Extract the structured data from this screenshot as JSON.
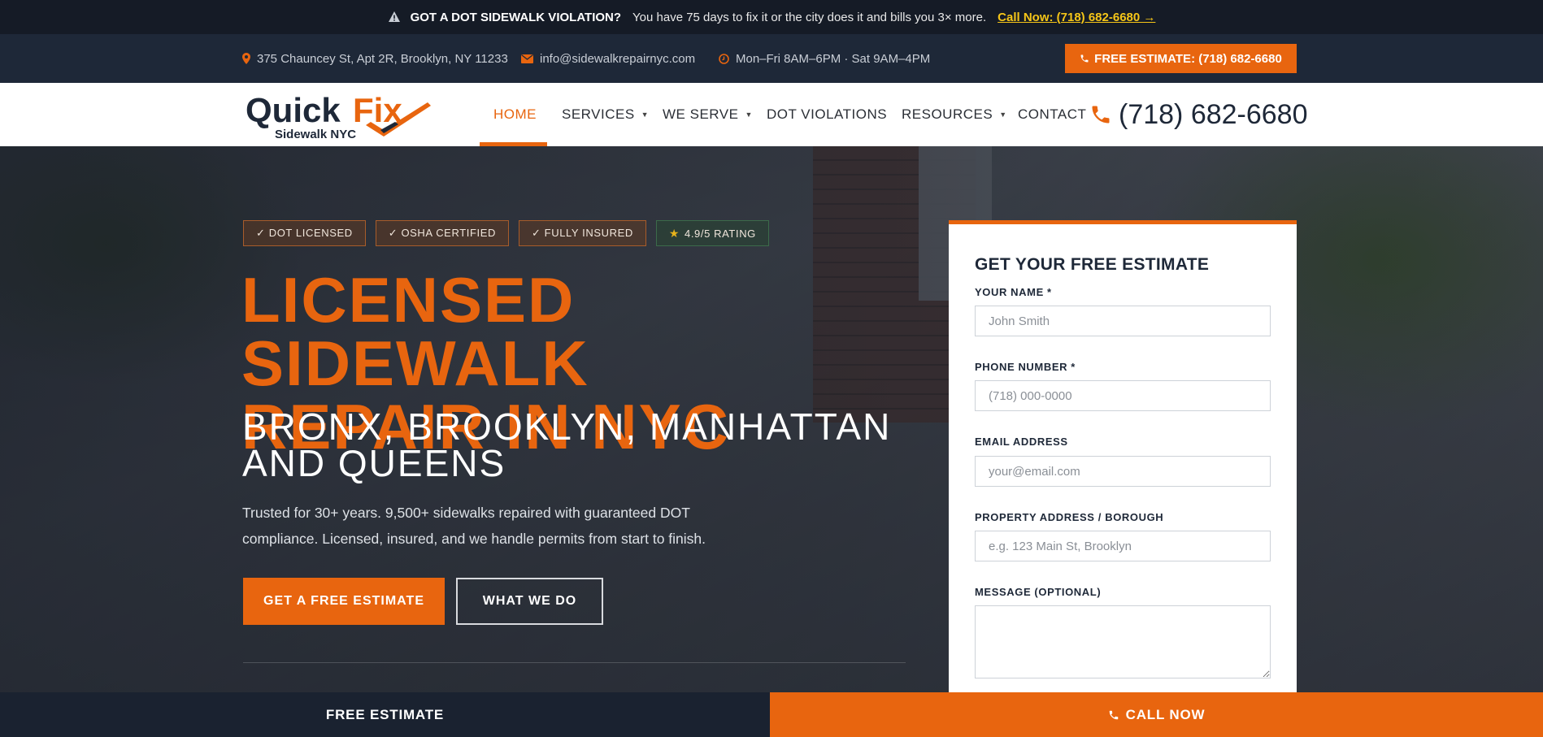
{
  "alert": {
    "headline": "GOT A DOT SIDEWALK VIOLATION?",
    "message": "You have 75 days to fix it or the city does it and bills you 3× more.",
    "call_link": "Call Now: (718) 682-6680 →"
  },
  "infobar": {
    "address": "375 Chauncey St, Apt 2R, Brooklyn, NY 11233",
    "email": "info@sidewalkrepairnyc.com",
    "hours": "Mon–Fri 8AM–6PM · Sat 9AM–4PM",
    "estimate_button": "FREE ESTIMATE: (718) 682-6680"
  },
  "logo": {
    "quick": "Quick",
    "fix": "Fix",
    "tagline": "Sidewalk NYC"
  },
  "nav": {
    "items": [
      {
        "label": "HOME"
      },
      {
        "label": "SERVICES"
      },
      {
        "label": "WE SERVE"
      },
      {
        "label": "DOT VIOLATIONS"
      },
      {
        "label": "RESOURCES"
      },
      {
        "label": "CONTACT"
      }
    ],
    "phone": "(718) 682-6680"
  },
  "hero": {
    "badges": [
      "✓ DOT LICENSED",
      "✓ OSHA CERTIFIED",
      "✓ FULLY INSURED",
      "4.9/5 RATING"
    ],
    "title_line1": "LICENSED SIDEWALK",
    "title_line2": "REPAIR IN NYC",
    "subtitle_line1": "BRONX, BROOKLYN, MANHATTAN",
    "subtitle_line2": "AND QUEENS",
    "paragraph_line1": "Trusted for 30+ years. 9,500+ sidewalks repaired with guaranteed DOT",
    "paragraph_line2": "compliance. Licensed, insured, and we handle permits from start to finish.",
    "primary_button": "GET A FREE ESTIMATE",
    "secondary_button": "WHAT WE DO"
  },
  "form": {
    "title": "GET YOUR FREE ESTIMATE",
    "name_label": "YOUR NAME *",
    "name_placeholder": "John Smith",
    "phone_label": "PHONE NUMBER *",
    "phone_placeholder": "(718) 000-0000",
    "email_label": "EMAIL ADDRESS",
    "email_placeholder": "your@email.com",
    "address_label": "PROPERTY ADDRESS / BOROUGH",
    "address_placeholder": "e.g. 123 Main St, Brooklyn",
    "message_label": "MESSAGE (OPTIONAL)"
  },
  "bottom_bar": {
    "estimate": "FREE ESTIMATE",
    "call": "CALL NOW"
  },
  "colors": {
    "accent": "#e8650f",
    "navy": "#1e2838",
    "alert_link": "#f5c518"
  }
}
